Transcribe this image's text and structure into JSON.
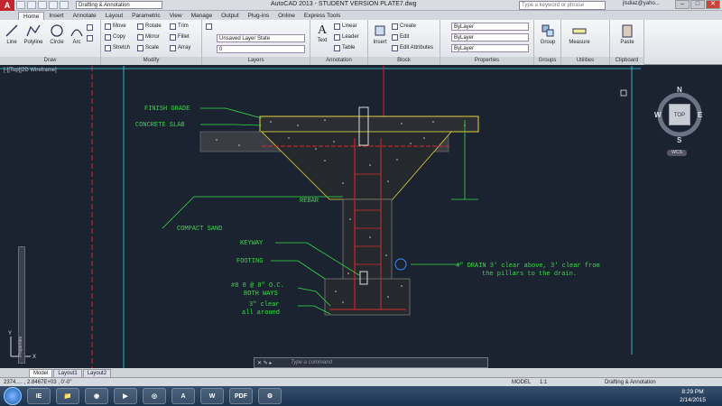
{
  "titlebar": {
    "workspace": "Drafting & Annotation",
    "title": "AutoCAD 2013 - STUDENT VERSION    PLATE7.dwg",
    "search_placeholder": "Type a keyword or phrase",
    "user": "jlsdiaz@yaho..."
  },
  "ribbon_tabs": [
    "Home",
    "Insert",
    "Annotate",
    "Layout",
    "Parametric",
    "View",
    "Manage",
    "Output",
    "Plug-ins",
    "Online",
    "Express Tools"
  ],
  "ribbon": {
    "draw": {
      "title": "Draw",
      "line": "Line",
      "polyline": "Polyline",
      "circle": "Circle",
      "arc": "Arc"
    },
    "modify": {
      "title": "Modify",
      "move": "Move",
      "rotate": "Rotate",
      "trim": "Trim",
      "copy": "Copy",
      "mirror": "Mirror",
      "fillet": "Fillet",
      "stretch": "Stretch",
      "scale": "Scale",
      "array": "Array"
    },
    "layers": {
      "title": "Layers",
      "state": "Unsaved Layer State",
      "current": "0"
    },
    "annotation": {
      "title": "Annotation",
      "text": "Text",
      "linear": "Linear",
      "leader": "Leader",
      "table": "Table"
    },
    "block": {
      "title": "Block",
      "insert": "Insert",
      "create": "Create",
      "edit": "Edit",
      "edit_attributes": "Edit Attributes"
    },
    "properties": {
      "title": "Properties",
      "color": "ByLayer",
      "linetype": "ByLayer",
      "lineweight": "ByLayer"
    },
    "groups": {
      "title": "Groups",
      "group": "Group"
    },
    "utilities": {
      "title": "Utilities",
      "measure": "Measure"
    },
    "clipboard": {
      "title": "Clipboard",
      "paste": "Paste"
    }
  },
  "viewport_label": "[-][Top][2D Wireframe]",
  "palette_label": "Properties",
  "viewcube": {
    "n": "N",
    "s": "S",
    "e": "E",
    "w": "W",
    "top": "TOP",
    "wcs": "WCS"
  },
  "drawing": {
    "finish_grade": "FINISH GRADE",
    "concrete_slab": "CONCRETE SLAB",
    "rebar": "REBAR",
    "compact_sand": "COMPACT SAND",
    "keyway": "KEYWAY",
    "footing": "FOOTING",
    "rebar_spec_1": "#8  8  @  8\" O.C.",
    "rebar_spec_2": "BOTH WAYS",
    "clear_1": "3\" clear",
    "clear_2": "all around",
    "drain_1": "4\"  DRAIN  3' clear above, 3' clear from",
    "drain_2": "the pillars to the drain."
  },
  "ucs": {
    "y": "Y",
    "x": "X"
  },
  "cmdline": {
    "buttons": "✕  ✎  ▸",
    "placeholder": "Type a command"
  },
  "layout_tabs": [
    "Model",
    "Layout1",
    "Layout2"
  ],
  "status": {
    "coords": "2374.… , 2.8467E+03 , 0'-0\"",
    "model": "MODEL",
    "scale": "1:1",
    "workspace": "Drafting & Annotation"
  },
  "taskbar": {
    "icons": [
      "IE",
      "📁",
      "◉",
      "▶",
      "◎",
      "A",
      "W",
      "PDF",
      "⚙"
    ],
    "time": "8:29 PM",
    "date": "2/14/2015"
  },
  "colors": {
    "background": "#1b2230",
    "annotation_green": "#33dd44",
    "slab_yellow": "#e6d23a",
    "section_red": "#d92a2a",
    "cyan_line": "#3ad6e6"
  }
}
